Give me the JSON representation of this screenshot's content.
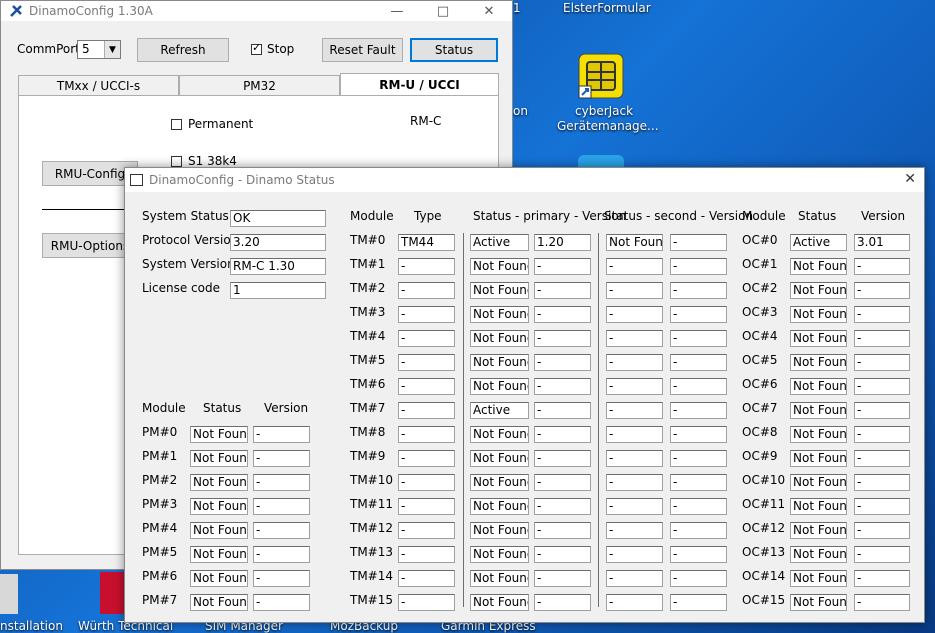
{
  "desktop": {
    "labels": {
      "elster": "ElsterFormular",
      "cyberjack1": "cyberJack",
      "cyberjack2": "Gerätemanage...",
      "on_fragment": "on",
      "one_fragment": "1",
      "bottom": [
        "nstallation",
        "Würth Technical",
        "SIM Manager",
        "MozBackup",
        "Garmin Express"
      ]
    }
  },
  "main_window": {
    "title": "DinamoConfig 1.30A",
    "commport_label": "CommPort",
    "commport_value": "5",
    "refresh_label": "Refresh",
    "stop_label": "Stop",
    "stop_checked": true,
    "reset_fault_label": "Reset Fault",
    "status_label": "Status",
    "tabs": [
      "TMxx / UCCI-s",
      "PM32",
      "RM-U / UCCI"
    ],
    "active_tab": 2,
    "permanent_label": "Permanent",
    "rmc_label": "RM-C",
    "s1_label": "S1 38k4",
    "rmu_config_label": "RMU-Config",
    "rmu_options_label": "RMU-Options"
  },
  "status_window": {
    "title": "DinamoConfig - Dinamo Status",
    "system": {
      "system_status_label": "System Status",
      "system_status_value": "OK",
      "protocol_version_label": "Protocol Version",
      "protocol_version_value": "3.20",
      "system_version_label": "System Version",
      "system_version_value": "RM-C 1.30",
      "license_code_label": "License code",
      "license_code_value": "1"
    },
    "pm_headers": {
      "module": "Module",
      "status": "Status",
      "version": "Version"
    },
    "pm_rows": [
      {
        "name": "PM#0",
        "status": "Not Found",
        "version": "-"
      },
      {
        "name": "PM#1",
        "status": "Not Found",
        "version": "-"
      },
      {
        "name": "PM#2",
        "status": "Not Found",
        "version": "-"
      },
      {
        "name": "PM#3",
        "status": "Not Found",
        "version": "-"
      },
      {
        "name": "PM#4",
        "status": "Not Found",
        "version": "-"
      },
      {
        "name": "PM#5",
        "status": "Not Found",
        "version": "-"
      },
      {
        "name": "PM#6",
        "status": "Not Found",
        "version": "-"
      },
      {
        "name": "PM#7",
        "status": "Not Found",
        "version": "-"
      }
    ],
    "tm_headers": {
      "module": "Module",
      "type": "Type",
      "primary": "Status - primary - Version",
      "second": "Status - second - Version"
    },
    "tm_rows": [
      {
        "name": "TM#0",
        "type": "TM44",
        "p_status": "Active",
        "p_version": "1.20",
        "s_status": "Not Found",
        "s_version": "-"
      },
      {
        "name": "TM#1",
        "type": "-",
        "p_status": "Not Found",
        "p_version": "-",
        "s_status": "-",
        "s_version": "-"
      },
      {
        "name": "TM#2",
        "type": "-",
        "p_status": "Not Found",
        "p_version": "-",
        "s_status": "-",
        "s_version": "-"
      },
      {
        "name": "TM#3",
        "type": "-",
        "p_status": "Not Found",
        "p_version": "-",
        "s_status": "-",
        "s_version": "-"
      },
      {
        "name": "TM#4",
        "type": "-",
        "p_status": "Not Found",
        "p_version": "-",
        "s_status": "-",
        "s_version": "-"
      },
      {
        "name": "TM#5",
        "type": "-",
        "p_status": "Not Found",
        "p_version": "-",
        "s_status": "-",
        "s_version": "-"
      },
      {
        "name": "TM#6",
        "type": "-",
        "p_status": "Not Found",
        "p_version": "-",
        "s_status": "-",
        "s_version": "-"
      },
      {
        "name": "TM#7",
        "type": "-",
        "p_status": "Active",
        "p_version": "-",
        "s_status": "-",
        "s_version": "-"
      },
      {
        "name": "TM#8",
        "type": "-",
        "p_status": "Not Found",
        "p_version": "-",
        "s_status": "-",
        "s_version": "-"
      },
      {
        "name": "TM#9",
        "type": "-",
        "p_status": "Not Found",
        "p_version": "-",
        "s_status": "-",
        "s_version": "-"
      },
      {
        "name": "TM#10",
        "type": "-",
        "p_status": "Not Found",
        "p_version": "-",
        "s_status": "-",
        "s_version": "-"
      },
      {
        "name": "TM#11",
        "type": "-",
        "p_status": "Not Found",
        "p_version": "-",
        "s_status": "-",
        "s_version": "-"
      },
      {
        "name": "TM#12",
        "type": "-",
        "p_status": "Not Found",
        "p_version": "-",
        "s_status": "-",
        "s_version": "-"
      },
      {
        "name": "TM#13",
        "type": "-",
        "p_status": "Not Found",
        "p_version": "-",
        "s_status": "-",
        "s_version": "-"
      },
      {
        "name": "TM#14",
        "type": "-",
        "p_status": "Not Found",
        "p_version": "-",
        "s_status": "-",
        "s_version": "-"
      },
      {
        "name": "TM#15",
        "type": "-",
        "p_status": "Not Found",
        "p_version": "-",
        "s_status": "-",
        "s_version": "-"
      }
    ],
    "oc_headers": {
      "module": "Module",
      "status": "Status",
      "version": "Version"
    },
    "oc_rows": [
      {
        "name": "OC#0",
        "status": "Active",
        "version": "3.01"
      },
      {
        "name": "OC#1",
        "status": "Not Found",
        "version": "-"
      },
      {
        "name": "OC#2",
        "status": "Not Found",
        "version": "-"
      },
      {
        "name": "OC#3",
        "status": "Not Found",
        "version": "-"
      },
      {
        "name": "OC#4",
        "status": "Not Found",
        "version": "-"
      },
      {
        "name": "OC#5",
        "status": "Not Found",
        "version": "-"
      },
      {
        "name": "OC#6",
        "status": "Not Found",
        "version": "-"
      },
      {
        "name": "OC#7",
        "status": "Not Found",
        "version": "-"
      },
      {
        "name": "OC#8",
        "status": "Not Found",
        "version": "-"
      },
      {
        "name": "OC#9",
        "status": "Not Found",
        "version": "-"
      },
      {
        "name": "OC#10",
        "status": "Not Found",
        "version": "-"
      },
      {
        "name": "OC#11",
        "status": "Not Found",
        "version": "-"
      },
      {
        "name": "OC#12",
        "status": "Not Found",
        "version": "-"
      },
      {
        "name": "OC#13",
        "status": "Not Found",
        "version": "-"
      },
      {
        "name": "OC#14",
        "status": "Not Found",
        "version": "-"
      },
      {
        "name": "OC#15",
        "status": "Not Found",
        "version": "-"
      }
    ]
  }
}
